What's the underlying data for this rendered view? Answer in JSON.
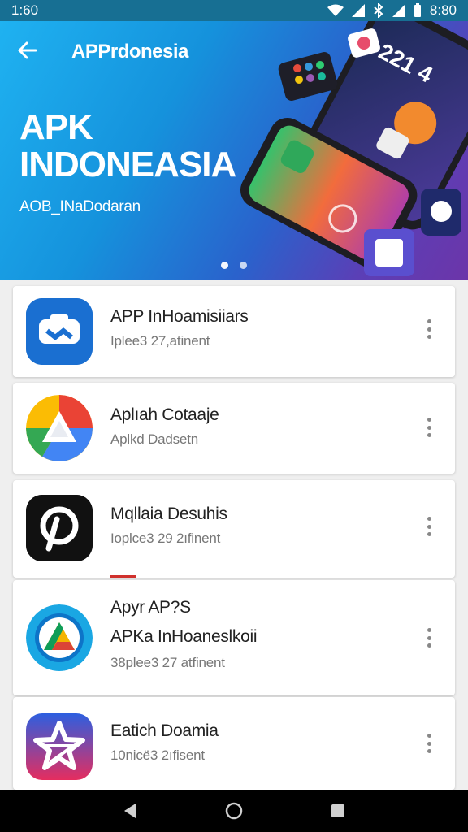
{
  "status_bar": {
    "time_left": "1:60",
    "time_right": "8:80"
  },
  "header": {
    "title": "APPrdonesia",
    "back_icon": "arrow-left-icon"
  },
  "hero": {
    "title_line1": "APK",
    "title_line2": "INDONEASIA",
    "subtitle": "AOB_INaDodaran",
    "colors": {
      "start": "#1fb2f1",
      "end": "#6c35a9"
    }
  },
  "apps": [
    {
      "name": "APP InHoamisiiars",
      "meta": "Iplee3 27,atinent",
      "icon": "vr-headset-icon"
    },
    {
      "name": "Aplıah Cotaaje",
      "meta": "Aplkd Dadsetn",
      "icon": "drive-triangle-icon"
    },
    {
      "name": "Mqllaia Desuhis",
      "meta": "Ioplce3 29 2ıfinent",
      "icon": "pinterest-p-icon"
    },
    {
      "name": "Apyr AP?S",
      "name2": "APKa InHoaneslkoii",
      "meta": "38plee3 27 atfinent",
      "icon": "drive-circle-icon"
    },
    {
      "name": "Eatich Doamia",
      "meta": "10nicë3 2ıfisent",
      "icon": "star-icon"
    }
  ],
  "nav": {
    "back": "back-triangle-icon",
    "home": "home-circle-icon",
    "recents": "recents-square-icon"
  }
}
